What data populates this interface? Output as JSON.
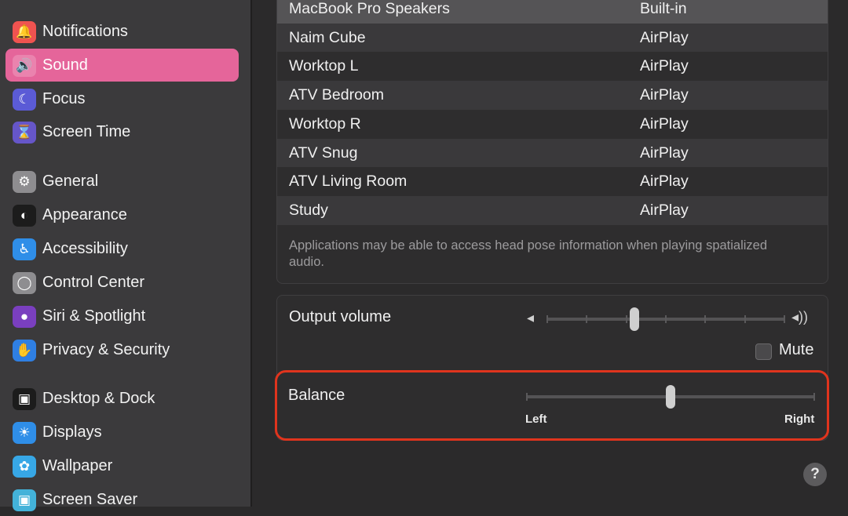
{
  "sidebar": {
    "items": [
      {
        "label": "Notifications",
        "icon": "bell-icon",
        "color": "#ef5350"
      },
      {
        "label": "Sound",
        "icon": "speaker-icon",
        "color": "#f04d68"
      },
      {
        "label": "Focus",
        "icon": "moon-icon",
        "color": "#5b5bd6"
      },
      {
        "label": "Screen Time",
        "icon": "hourglass-icon",
        "color": "#6656c9"
      },
      {
        "label": "General",
        "icon": "gear-icon",
        "color": "#8e8d90"
      },
      {
        "label": "Appearance",
        "icon": "appearance-icon",
        "color": "#1c1c1c"
      },
      {
        "label": "Accessibility",
        "icon": "accessibility-icon",
        "color": "#2f8ee8"
      },
      {
        "label": "Control Center",
        "icon": "toggles-icon",
        "color": "#8e8d90"
      },
      {
        "label": "Siri & Spotlight",
        "icon": "siri-icon",
        "color": "#7a3fbf"
      },
      {
        "label": "Privacy & Security",
        "icon": "hand-icon",
        "color": "#2f7fe3"
      },
      {
        "label": "Desktop & Dock",
        "icon": "dock-icon",
        "color": "#1c1c1c"
      },
      {
        "label": "Displays",
        "icon": "sun-icon",
        "color": "#2f8ee8"
      },
      {
        "label": "Wallpaper",
        "icon": "flower-icon",
        "color": "#37a7e6"
      },
      {
        "label": "Screen Saver",
        "icon": "screensaver-icon",
        "color": "#43b2d9"
      }
    ],
    "selected": "Sound"
  },
  "devices": [
    {
      "name": "MacBook Pro Speakers",
      "type": "Built-in"
    },
    {
      "name": "Naim Cube",
      "type": "AirPlay"
    },
    {
      "name": "Worktop L",
      "type": "AirPlay"
    },
    {
      "name": "ATV Bedroom",
      "type": "AirPlay"
    },
    {
      "name": "Worktop R",
      "type": "AirPlay"
    },
    {
      "name": "ATV Snug",
      "type": "AirPlay"
    },
    {
      "name": "ATV Living Room",
      "type": "AirPlay"
    },
    {
      "name": "Study",
      "type": "AirPlay"
    }
  ],
  "spatial_note": "Applications may be able to access head pose information when playing spatialized audio.",
  "output": {
    "label": "Output volume",
    "volume_fraction": 0.37,
    "mute_label": "Mute",
    "muted": false
  },
  "balance": {
    "label": "Balance",
    "left_label": "Left",
    "right_label": "Right",
    "value_fraction": 0.5
  },
  "help_label": "?",
  "colors": {
    "highlight_outline": "#e0341d",
    "selected_sidebar": "#e5659a"
  }
}
